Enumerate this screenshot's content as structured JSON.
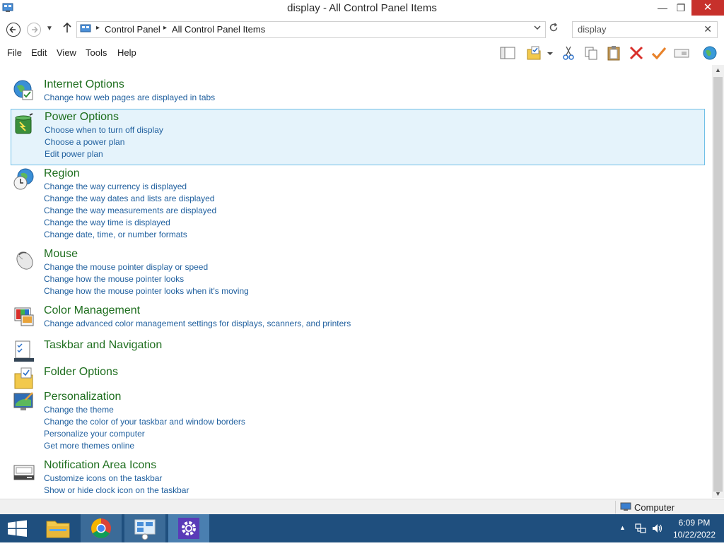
{
  "window": {
    "title": "display - All Control Panel Items",
    "minimize": "—",
    "maximize": "❐",
    "close": "✕"
  },
  "address": {
    "breadcrumbs": [
      "Control Panel",
      "All Control Panel Items"
    ],
    "separator": "▸",
    "search_value": "display"
  },
  "menu": [
    "File",
    "Edit",
    "View",
    "Tools",
    "Help"
  ],
  "toolbar_icons": [
    "layout-icon",
    "folder-options-icon",
    "cut-icon",
    "copy-icon",
    "paste-icon",
    "delete-icon",
    "properties-icon",
    "rename-icon",
    "globe-icon"
  ],
  "results": [
    {
      "title": "Internet Options",
      "icon": "internet-options-icon",
      "links": [
        "Change how web pages are displayed in tabs"
      ]
    },
    {
      "title": "Power Options",
      "icon": "power-options-icon",
      "selected": true,
      "links": [
        "Choose when to turn off display",
        "Choose a power plan",
        "Edit power plan"
      ]
    },
    {
      "title": "Region",
      "icon": "region-icon",
      "links": [
        "Change the way currency is displayed",
        "Change the way dates and lists are displayed",
        "Change the way measurements are displayed",
        "Change the way time is displayed",
        "Change date, time, or number formats"
      ]
    },
    {
      "title": "Mouse",
      "icon": "mouse-icon",
      "links": [
        "Change the mouse pointer display or speed",
        "Change how the mouse pointer looks",
        "Change how the mouse pointer looks when it's moving"
      ]
    },
    {
      "title": "Color Management",
      "icon": "color-management-icon",
      "links": [
        "Change advanced color management settings for displays, scanners, and printers"
      ]
    },
    {
      "title": "Taskbar and Navigation",
      "icon": "taskbar-icon",
      "links": []
    },
    {
      "title": "Folder Options",
      "icon": "folder-options-icon",
      "links": []
    },
    {
      "title": "Personalization",
      "icon": "personalization-icon",
      "links": [
        "Change the theme",
        "Change the color of your taskbar and window borders",
        "Personalize your computer",
        "Get more themes online"
      ]
    },
    {
      "title": "Notification Area Icons",
      "icon": "notification-area-icon",
      "links": [
        "Customize icons on the taskbar",
        "Show or hide clock icon on the taskbar"
      ]
    }
  ],
  "status": {
    "text": "Computer"
  },
  "taskbar": {
    "time": "6:09 PM",
    "date": "10/22/2022",
    "tray_arrow": "▲"
  },
  "colors": {
    "title_link": "#1e6e1e",
    "task_link": "#1f5f9e",
    "selection_bg": "#e5f3fb",
    "selection_border": "#70c0e7",
    "taskbar_bg": "#1f4f7e",
    "close_bg": "#c7302b"
  }
}
